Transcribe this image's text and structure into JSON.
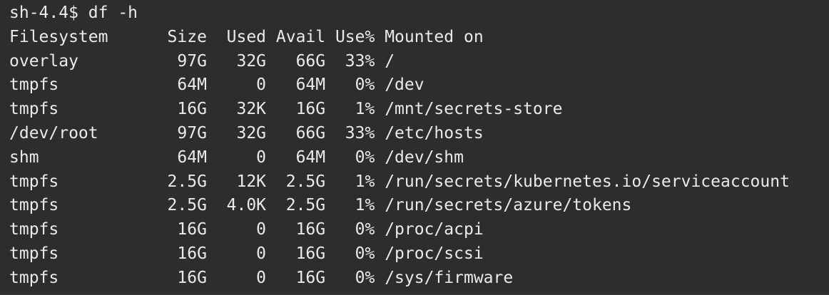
{
  "terminal": {
    "prompt": "sh-4.4$",
    "command": "df -h",
    "lines": [
      "Filesystem      Size  Used Avail Use% Mounted on",
      "overlay          97G   32G   66G  33% /",
      "tmpfs            64M     0   64M   0% /dev",
      "tmpfs            16G   32K   16G   1% /mnt/secrets-store",
      "/dev/root        97G   32G   66G  33% /etc/hosts",
      "shm              64M     0   64M   0% /dev/shm",
      "tmpfs           2.5G   12K  2.5G   1% /run/secrets/kubernetes.io/serviceaccount",
      "tmpfs           2.5G  4.0K  2.5G   1% /run/secrets/azure/tokens",
      "tmpfs            16G     0   16G   0% /proc/acpi",
      "tmpfs            16G     0   16G   0% /proc/scsi",
      "tmpfs            16G     0   16G   0% /sys/firmware"
    ]
  },
  "colors": {
    "background": "#2b2d2f",
    "foreground": "#eaeaea"
  }
}
